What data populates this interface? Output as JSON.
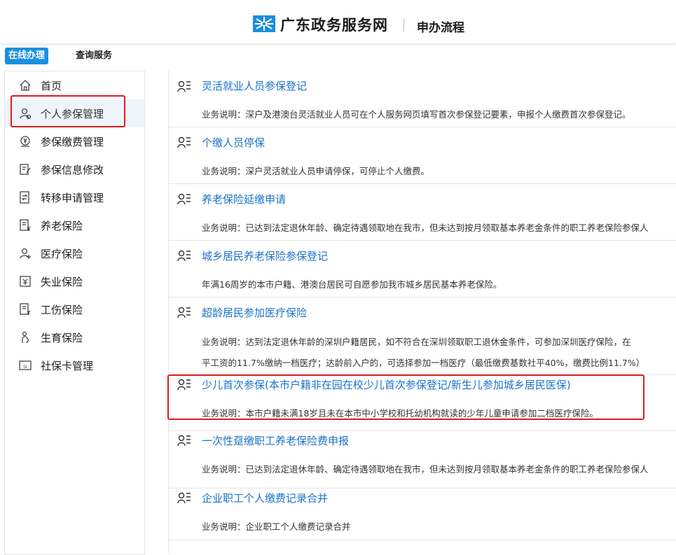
{
  "header": {
    "brand": "广东政务服务网",
    "process": "申办流程",
    "logo_icon": "snowflake-logo-icon",
    "brand_color": "#1a8fe0"
  },
  "tabs": {
    "online": "在线办理",
    "query": "查询服务"
  },
  "sidebar": {
    "items": [
      {
        "label": "首页",
        "icon": "home-icon"
      },
      {
        "label": "个人参保管理",
        "icon": "person-icon"
      },
      {
        "label": "参保缴费管理",
        "icon": "payment-icon"
      },
      {
        "label": "参保信息修改",
        "icon": "edit-document-icon"
      },
      {
        "label": "转移申请管理",
        "icon": "transfer-icon"
      },
      {
        "label": "养老保险",
        "icon": "pension-document-icon"
      },
      {
        "label": "医疗保险",
        "icon": "medical-person-icon"
      },
      {
        "label": "失业保险",
        "icon": "unemployment-icon"
      },
      {
        "label": "工伤保险",
        "icon": "injury-document-icon"
      },
      {
        "label": "生育保险",
        "icon": "maternity-icon"
      },
      {
        "label": "社保卡管理",
        "icon": "card-icon"
      }
    ]
  },
  "services": [
    {
      "title": "灵活就业人员参保登记",
      "desc": "业务说明：深户及港澳台灵活就业人员可在个人服务网页填写首次参保登记要素，申报个人缴费首次参保登记。"
    },
    {
      "title": "个缴人员停保",
      "desc": "业务说明：深户灵活就业人员申请停保，可停止个人缴费。"
    },
    {
      "title": "养老保险延缴申请",
      "desc": "业务说明：已达到法定退休年龄、确定待遇领取地在我市，但未达到按月领取基本养老金条件的职工养老保险参保人"
    },
    {
      "title": "城乡居民养老保险参保登记",
      "desc": "年满16周岁的本市户籍、港澳台居民可自愿参加我市城乡居民基本养老保险。"
    },
    {
      "title": "超龄居民参加医疗保险",
      "desc": "业务说明：达到法定退休年龄的深圳户籍居民，如不符合在深圳领取职工退休金条件，可参加深圳医疗保险，在",
      "desc2": "平工资的11.7%缴纳一档医疗；达龄前入户的，可选择参加一档医疗（最低缴费基数社平40%，缴费比例11.7%）"
    },
    {
      "title": "少儿首次参保(本市户籍非在园在校少儿首次参保登记/新生儿参加城乡居民医保)",
      "desc": "业务说明：本市户籍未满18岁且未在本市中小学校和托幼机构就读的少年儿童申请参加二档医疗保险。"
    },
    {
      "title": "一次性趸缴职工养老保险费申报",
      "desc": "业务说明：已达到法定退休年龄、确定待遇领取地在我市，但未达到按月领取基本养老金条件的职工养老保险参保人"
    },
    {
      "title": "企业职工个人缴费记录合并",
      "desc": "业务说明：企业职工个人缴费记录合并"
    }
  ],
  "service_icon": "person-list-icon",
  "highlight_color": "#e01a1a",
  "link_color": "#1a73c8"
}
